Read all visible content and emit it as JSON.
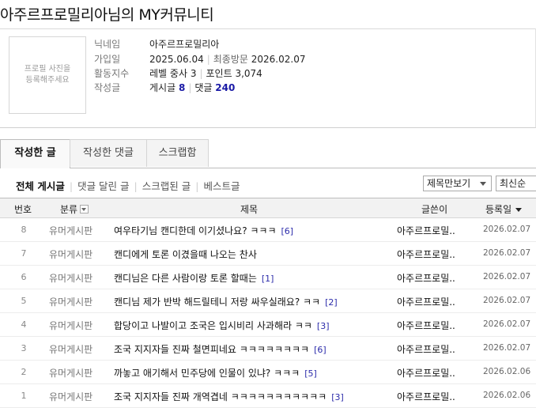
{
  "page_title": "아주르프로밀리아님의 MY커뮤니티",
  "profile": {
    "photo_placeholder": "프로필 사진을\n등록해주세요",
    "nickname_label": "닉네임",
    "nickname": "아주르프로밀리아",
    "joined_label": "가입일",
    "joined": "2025.06.04",
    "last_visit_label": "최종방문",
    "last_visit": "2026.02.07",
    "activity_label": "활동지수",
    "level_label": "레벨",
    "level_value": "중사 3",
    "points_label": "포인트",
    "points_value": "3,074",
    "written_label": "작성글",
    "posts_label": "게시글",
    "posts_count": "8",
    "comments_label": "댓글",
    "comments_count": "240"
  },
  "tabs": [
    {
      "label": "작성한 글",
      "active": true
    },
    {
      "label": "작성한 댓글",
      "active": false
    },
    {
      "label": "스크랩함",
      "active": false
    }
  ],
  "subnav": [
    {
      "label": "전체 게시글",
      "active": true
    },
    {
      "label": "댓글 달린 글",
      "active": false
    },
    {
      "label": "스크랩된 글",
      "active": false
    },
    {
      "label": "베스트글",
      "active": false
    }
  ],
  "filters": {
    "view_mode": "제목만보기",
    "sort": "최신순"
  },
  "table": {
    "headers": {
      "num": "번호",
      "category": "분류",
      "title": "제목",
      "author": "글쓴이",
      "date": "등록일"
    },
    "rows": [
      {
        "num": "8",
        "category": "유머게시판",
        "title": "여우타기님 캔디한데 이기셨나요? ㅋㅋㅋ",
        "comments": "[6]",
        "author": "아주르프로밀..",
        "date": "2026.02.07"
      },
      {
        "num": "7",
        "category": "유머게시판",
        "title": "캔디에게 토론 이겼을때 나오는 찬사",
        "comments": "",
        "author": "아주르프로밀..",
        "date": "2026.02.07"
      },
      {
        "num": "6",
        "category": "유머게시판",
        "title": "캔디님은 다른 사람이랑 토론 할때는",
        "comments": "[1]",
        "author": "아주르프로밀..",
        "date": "2026.02.07"
      },
      {
        "num": "5",
        "category": "유머게시판",
        "title": "캔디님 제가 반박 해드릴테니 저랑 싸우실래요? ㅋㅋ",
        "comments": "[2]",
        "author": "아주르프로밀..",
        "date": "2026.02.07"
      },
      {
        "num": "4",
        "category": "유머게시판",
        "title": "합당이고 나발이고 조국은 입시비리 사과해라 ㅋㅋ",
        "comments": "[3]",
        "author": "아주르프로밀..",
        "date": "2026.02.07"
      },
      {
        "num": "3",
        "category": "유머게시판",
        "title": "조국 지지자들 진짜 철면피네요 ㅋㅋㅋㅋㅋㅋㅋㅋ",
        "comments": "[6]",
        "author": "아주르프로밀..",
        "date": "2026.02.07"
      },
      {
        "num": "2",
        "category": "유머게시판",
        "title": "까놓고 애기해서 민주당에 인물이 있냐? ㅋㅋㅋ",
        "comments": "[5]",
        "author": "아주르프로밀..",
        "date": "2026.02.06"
      },
      {
        "num": "1",
        "category": "유머게시판",
        "title": "조국 지지자들 진짜 개역겹네 ㅋㅋㅋㅋㅋㅋㅋㅋㅋㅋㅋ",
        "comments": "[3]",
        "author": "아주르프로밀..",
        "date": "2026.02.06"
      }
    ]
  }
}
